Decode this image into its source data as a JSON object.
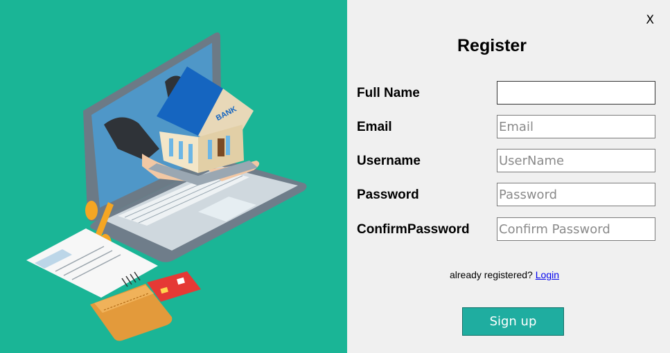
{
  "window": {
    "close_label": "X"
  },
  "form": {
    "title": "Register",
    "fields": [
      {
        "label": "Full Name",
        "placeholder": "",
        "value": ""
      },
      {
        "label": "Email",
        "placeholder": "Email",
        "value": ""
      },
      {
        "label": "Username",
        "placeholder": "UserName",
        "value": ""
      },
      {
        "label": "Password",
        "placeholder": "Password",
        "value": ""
      },
      {
        "label": "ConfirmPassword",
        "placeholder": "Confirm Password",
        "value": ""
      }
    ],
    "already_text": "already registered?",
    "login_link": "Login",
    "signup_label": "Sign up"
  },
  "illustration": {
    "bank_sign": "BANK"
  },
  "colors": {
    "left_panel": "#1ab596",
    "button": "#1fada0",
    "link": "#0000ee"
  }
}
